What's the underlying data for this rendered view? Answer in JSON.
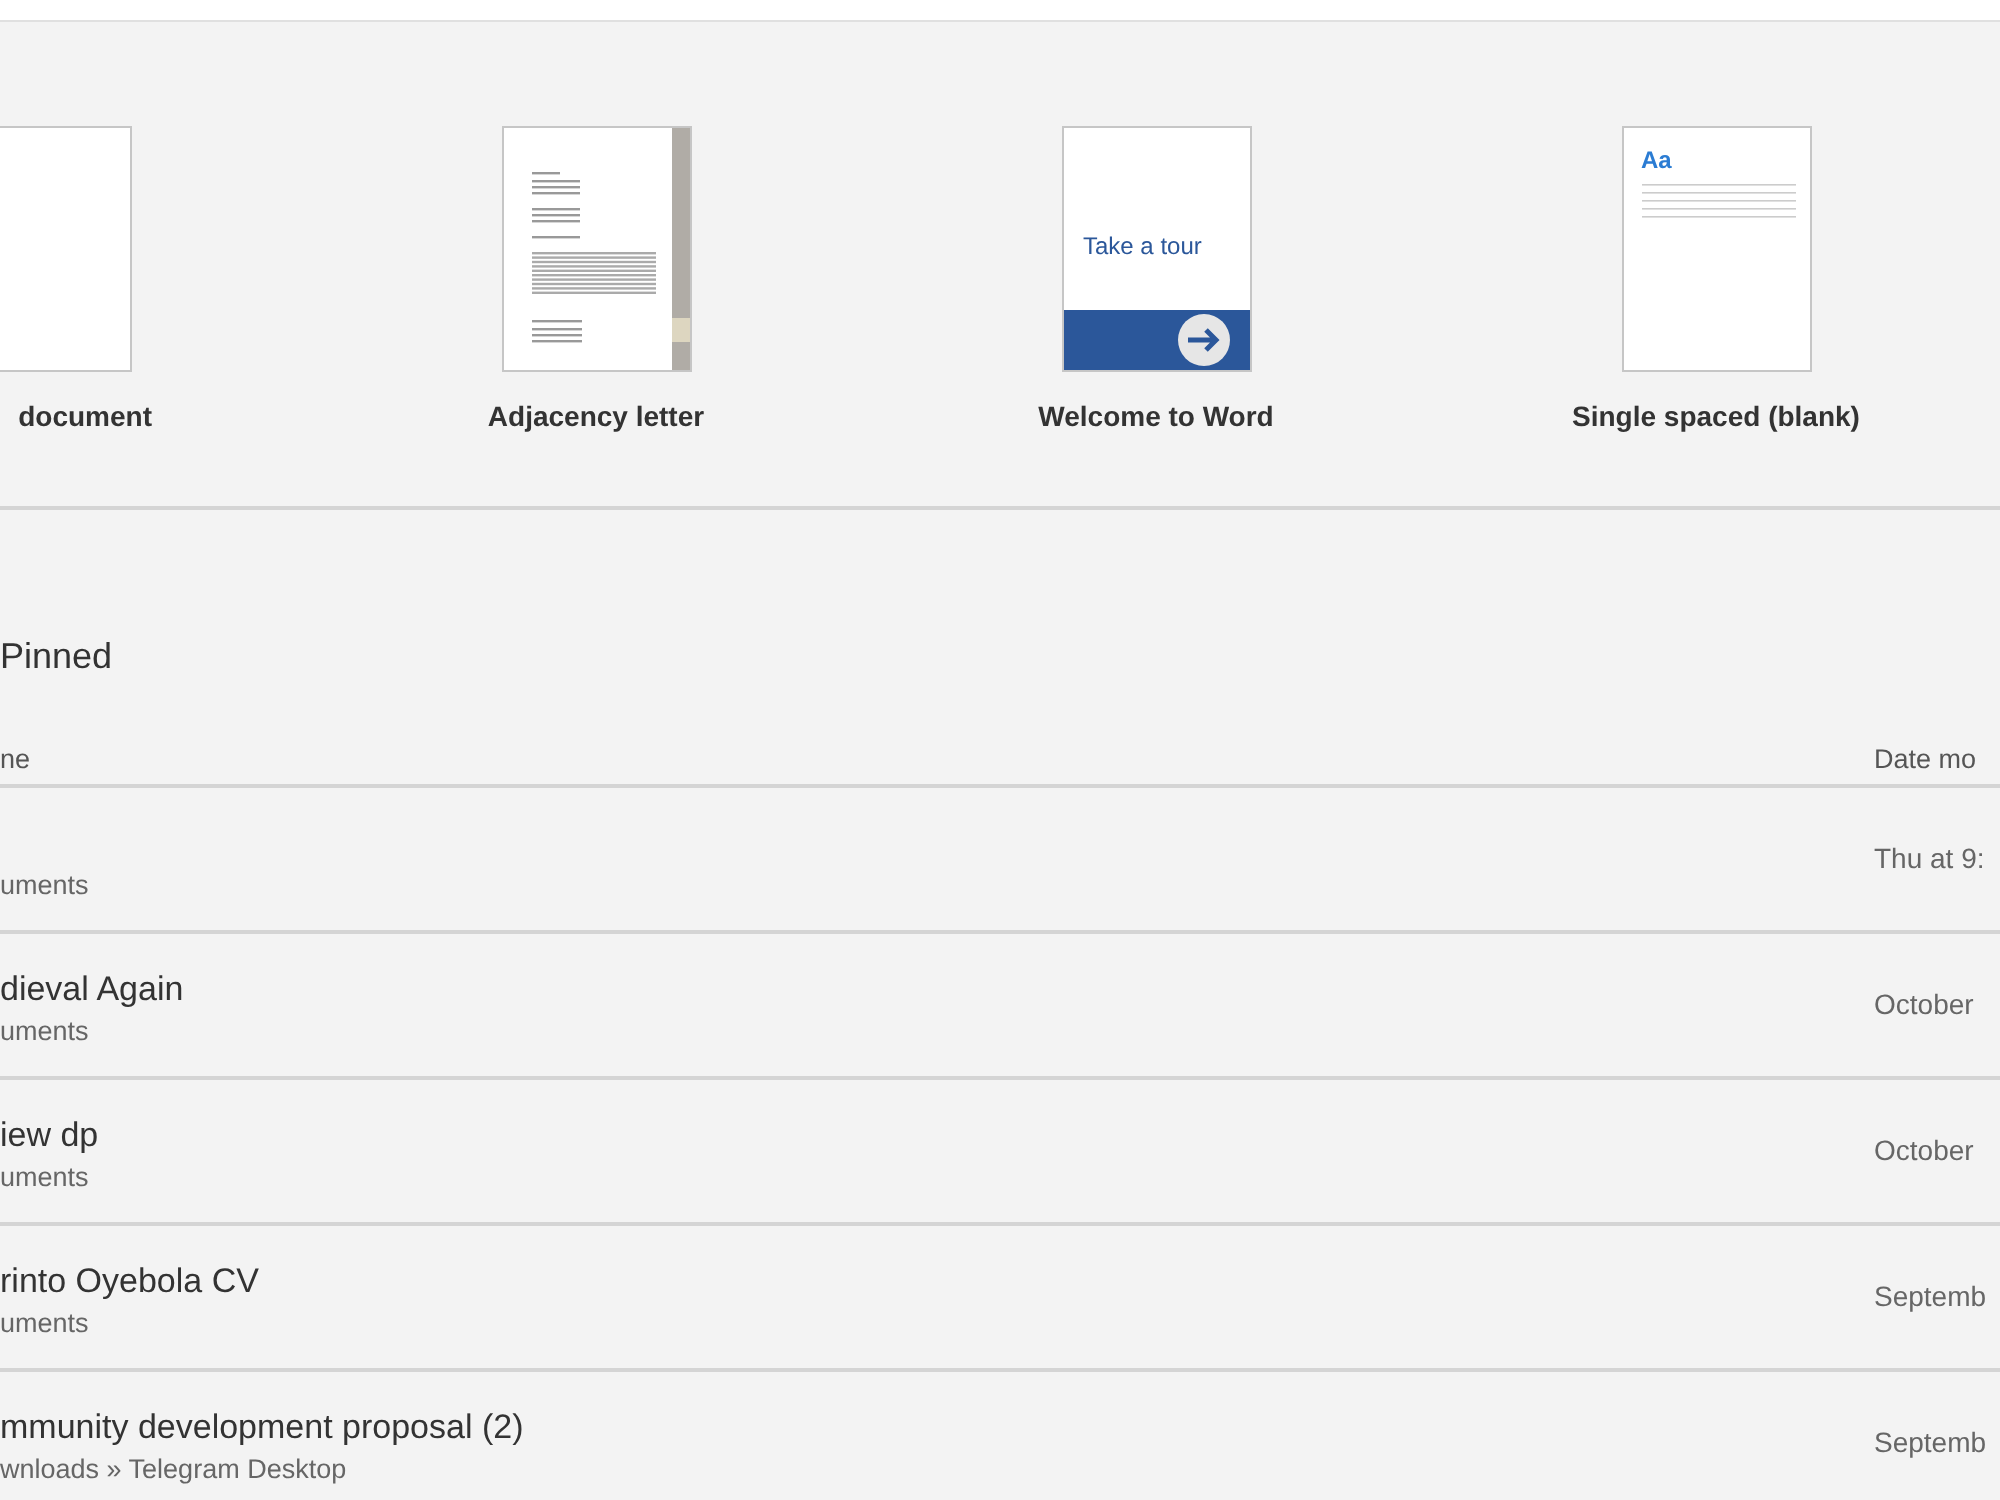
{
  "templates": [
    {
      "kind": "blank",
      "label": "document"
    },
    {
      "kind": "letter",
      "label": "Adjacency letter"
    },
    {
      "kind": "tour",
      "label": "Welcome to Word",
      "thumb_text": "Take a tour"
    },
    {
      "kind": "spaced",
      "label": "Single spaced (blank)",
      "thumb_text": "Aa"
    }
  ],
  "pinned": {
    "title": "Pinned"
  },
  "table": {
    "columns": [
      "ne",
      "Date mo"
    ],
    "rows": [
      {
        "location": "uments",
        "date": "Thu at 9:"
      },
      {
        "name": "dieval Again",
        "location": "uments",
        "date": "October"
      },
      {
        "name": "iew dp",
        "location": "uments",
        "date": "October"
      },
      {
        "name": "rinto Oyebola CV",
        "location": "uments",
        "date": "Septemb"
      },
      {
        "name": "mmunity development proposal (2)",
        "location": "wnloads » Telegram Desktop",
        "date": "Septemb"
      }
    ]
  }
}
